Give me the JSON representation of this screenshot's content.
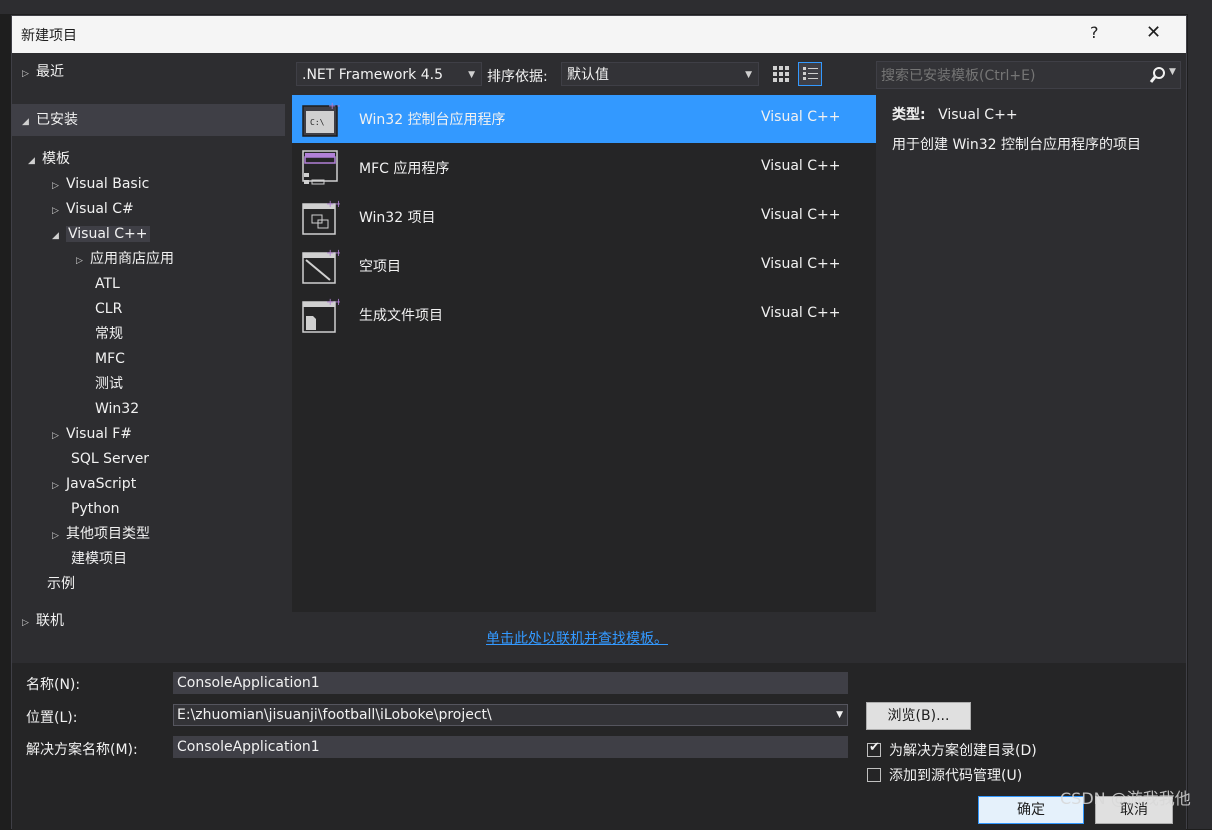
{
  "dialog": {
    "title": "新建项目",
    "help_label": "?",
    "close_label": "✕"
  },
  "tree": {
    "recent": "最近",
    "installed": "已安装",
    "templates": "模板",
    "items": {
      "vb": "Visual Basic",
      "vcs": "Visual C#",
      "vcpp": "Visual C++",
      "store": "应用商店应用",
      "atl": "ATL",
      "clr": "CLR",
      "general": "常规",
      "mfc": "MFC",
      "test": "测试",
      "win32": "Win32",
      "vfs": "Visual F#",
      "sql": "SQL Server",
      "js": "JavaScript",
      "python": "Python",
      "other": "其他项目类型",
      "modeling": "建模项目"
    },
    "samples": "示例",
    "online": "联机"
  },
  "toolbar": {
    "framework": ".NET Framework 4.5",
    "sort_label": "排序依据:",
    "sort_value": "默认值"
  },
  "search": {
    "placeholder": "搜索已安装模板(Ctrl+E)"
  },
  "templates": [
    {
      "name": "Win32 控制台应用程序",
      "lang": "Visual C++",
      "icon_text": "C:\\"
    },
    {
      "name": "MFC 应用程序",
      "lang": "Visual C++"
    },
    {
      "name": "Win32 项目",
      "lang": "Visual C++"
    },
    {
      "name": "空项目",
      "lang": "Visual C++"
    },
    {
      "name": "生成文件项目",
      "lang": "Visual C++"
    }
  ],
  "description": {
    "type_label": "类型:",
    "type_value": "Visual C++",
    "text": "用于创建 Win32 控制台应用程序的项目"
  },
  "online_link": "单击此处以联机并查找模板。",
  "form": {
    "name_label": "名称(N):",
    "name_value": "ConsoleApplication1",
    "location_label": "位置(L):",
    "location_value": "E:\\zhuomian\\jisuanji\\football\\iLoboke\\project\\",
    "solution_label": "解决方案名称(M):",
    "solution_value": "ConsoleApplication1",
    "browse": "浏览(B)...",
    "create_dir": "为解决方案创建目录(D)",
    "add_scc": "添加到源代码管理(U)",
    "ok": "确定",
    "cancel": "取消"
  },
  "watermark": "CSDN @游我我他",
  "colors": {
    "accent": "#3399ff",
    "dialog_bg": "#2d2d30",
    "list_bg": "#252526"
  }
}
